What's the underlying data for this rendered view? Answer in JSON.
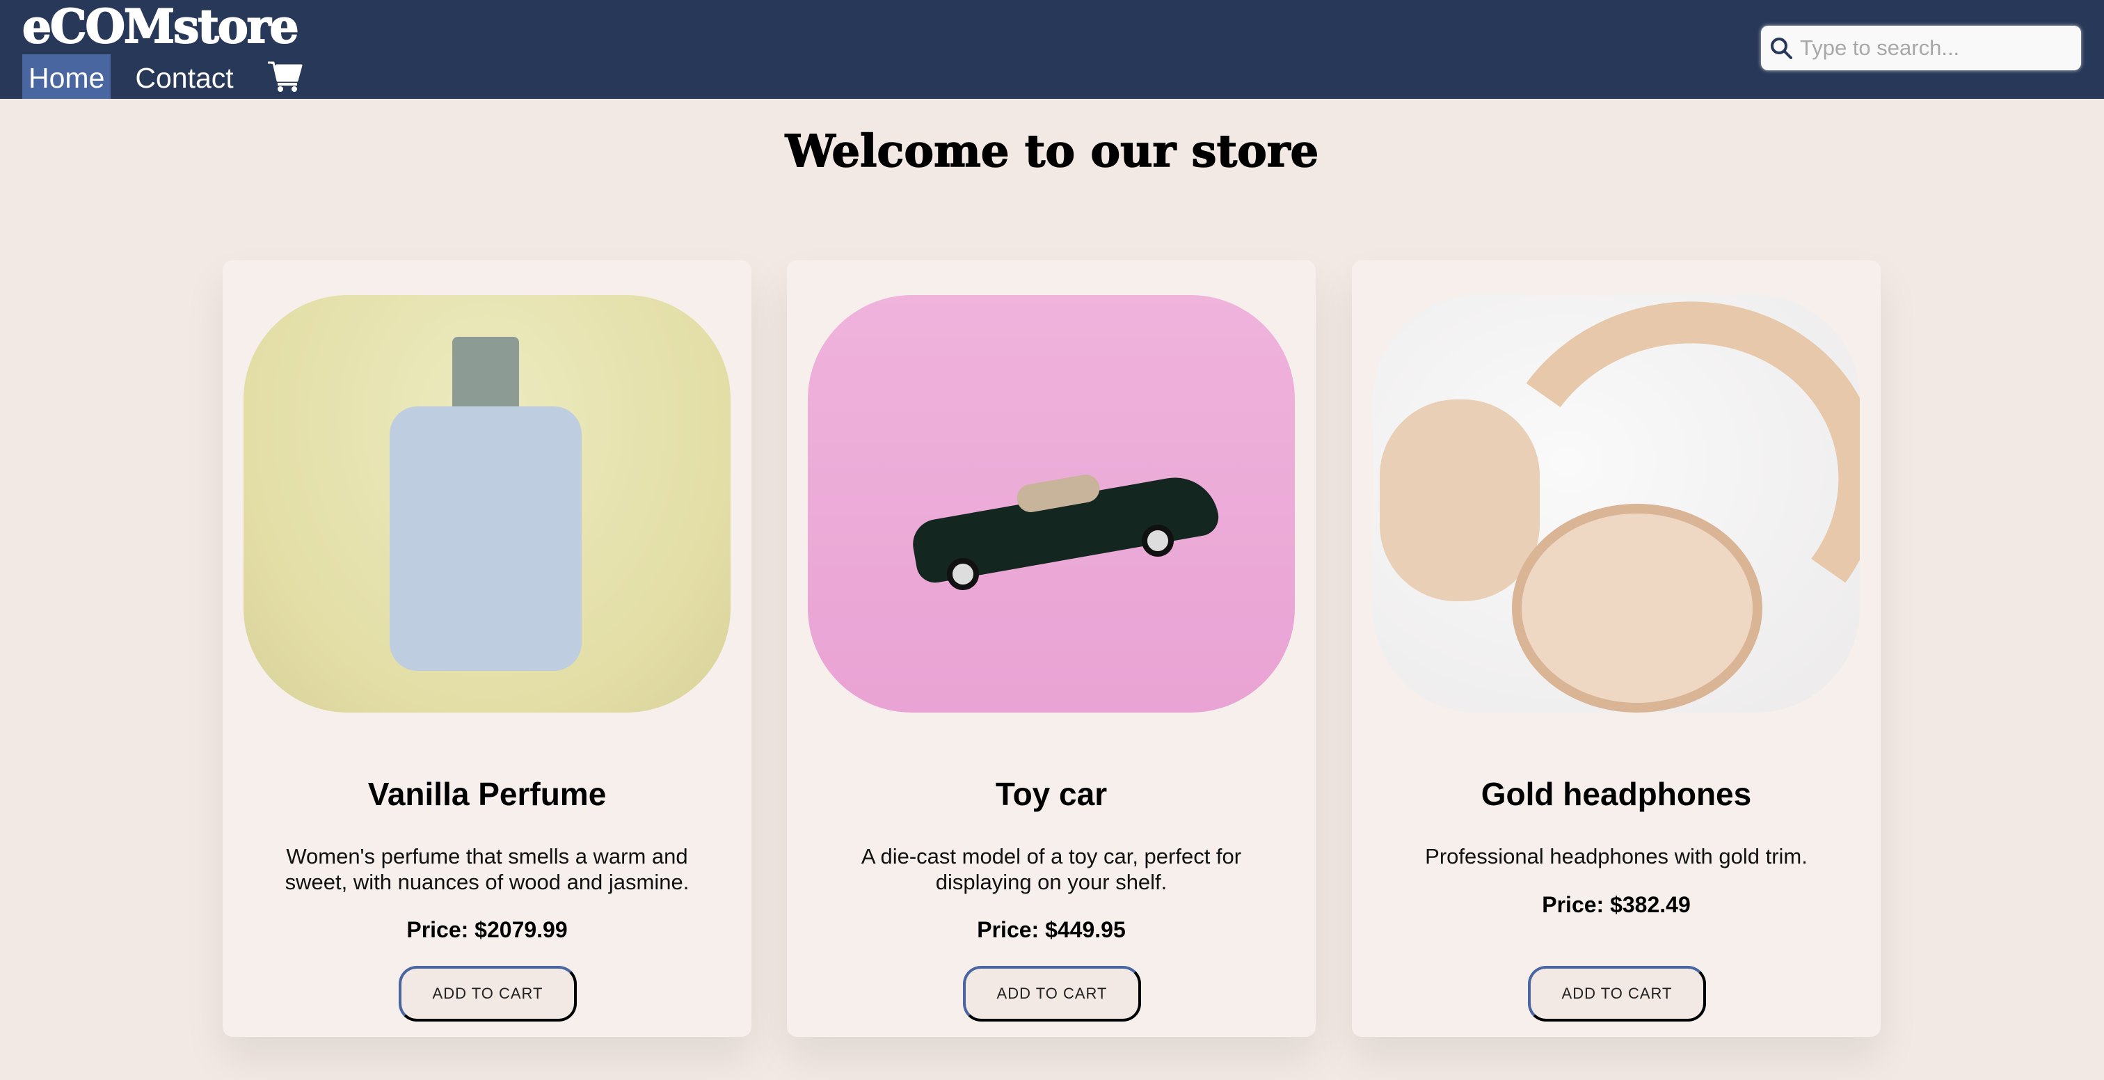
{
  "header": {
    "logo": "eCOMstore",
    "nav": [
      {
        "label": "Home",
        "active": true
      },
      {
        "label": "Contact",
        "active": false
      }
    ],
    "cart_icon": "shopping-cart-icon",
    "search": {
      "placeholder": "Type to search...",
      "value": "",
      "icon": "search-icon"
    }
  },
  "colors": {
    "nav_bg": "#283858",
    "nav_active": "#4a66a0",
    "page_bg": "#f2e9e4",
    "card_bg": "#f6efec"
  },
  "main": {
    "title": "Welcome to our store",
    "products": [
      {
        "name": "Vanilla Perfume",
        "description": "Women's perfume that smells a warm and sweet, with nuances of wood and jasmine.",
        "price": "Price: $2079.99",
        "button": "ADD TO CART",
        "image": "perfume-bottle-image"
      },
      {
        "name": "Toy car",
        "description": "A die-cast model of a toy car, perfect for displaying on your shelf.",
        "price": "Price: $449.95",
        "button": "ADD TO CART",
        "image": "toy-car-image"
      },
      {
        "name": "Gold headphones",
        "description": "Professional headphones with gold trim.",
        "price": "Price: $382.49",
        "button": "ADD TO CART",
        "image": "headphones-image"
      }
    ]
  }
}
